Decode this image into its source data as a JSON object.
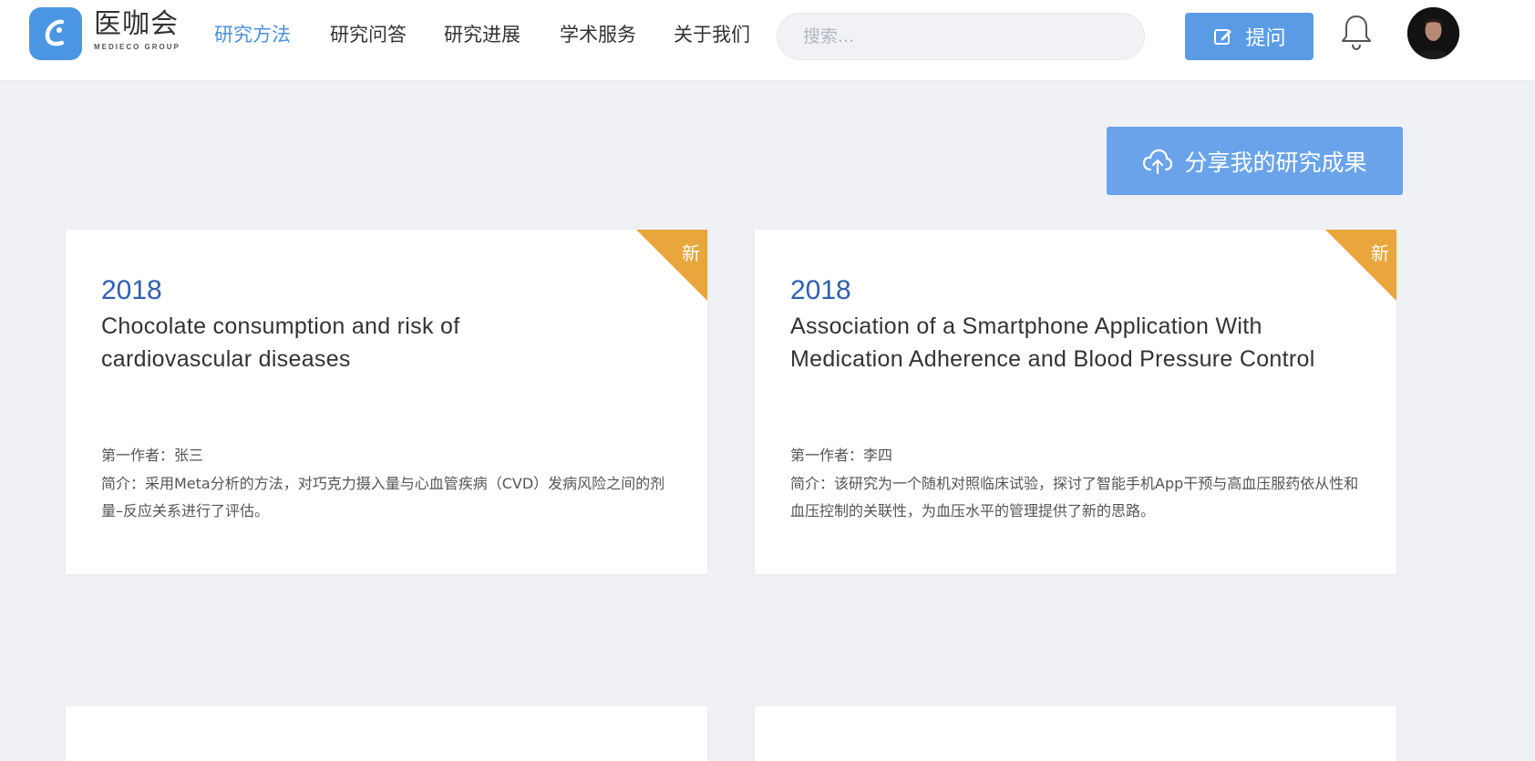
{
  "brand": {
    "name_cn": "医咖会",
    "name_en": "MEDIECO GROUP",
    "color": "#4a96e2"
  },
  "nav": {
    "items": [
      {
        "label": "研究方法",
        "active": true
      },
      {
        "label": "研究问答",
        "active": false
      },
      {
        "label": "研究进展",
        "active": false
      },
      {
        "label": "学术服务",
        "active": false
      },
      {
        "label": "关于我们",
        "active": false
      }
    ],
    "active_color": "#4a8fe0"
  },
  "search": {
    "placeholder": "搜索...",
    "value": ""
  },
  "header_actions": {
    "ask_label": "提问",
    "ask_icon": "edit-icon",
    "notification_icon": "bell-icon"
  },
  "share": {
    "label": "分享我的研究成果",
    "icon": "cloud-upload-icon",
    "color": "#6aa3ea"
  },
  "cards": [
    {
      "badge": "新",
      "year": "2018",
      "title": "Chocolate consumption and risk of cardiovascular diseases",
      "author": "第一作者：张三",
      "intro": "简介：采用Meta分析的方法，对巧克力摄入量与心血管疾病（CVD）发病风险之间的剂量–反应关系进行了评估。"
    },
    {
      "badge": "新",
      "year": "2018",
      "title": "Association of a Smartphone Application With Medication Adherence and Blood Pressure Control",
      "author": "第一作者：李四",
      "intro": "简介：该研究为一个随机对照临床试验，探讨了智能手机App干预与高血压服药依从性和血压控制的关联性，为血压水平的管理提供了新的思路。"
    }
  ],
  "colors": {
    "badge": "#e8a63c",
    "year": "#2f5fb0",
    "background": "#f0f1f4"
  }
}
